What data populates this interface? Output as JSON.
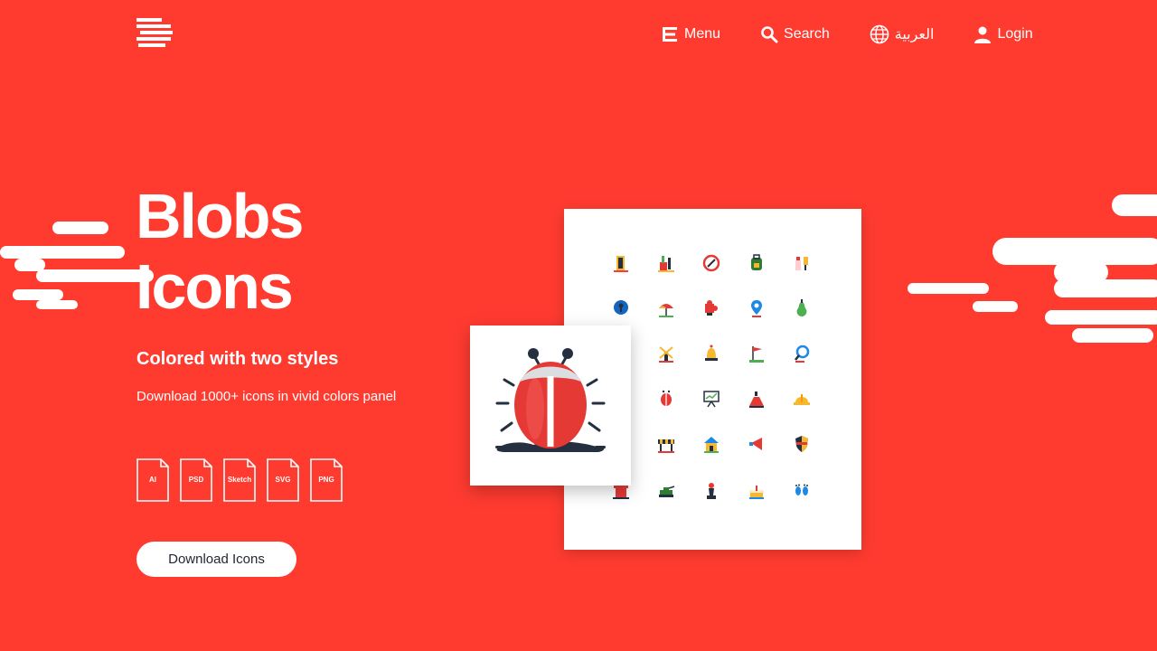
{
  "nav": {
    "menu_label": "Menu",
    "search_label": "Search",
    "language_label": "العربية",
    "login_label": "Login"
  },
  "hero": {
    "title_line1": "Blobs",
    "title_line2": "Icons",
    "subtitle": "Colored with two styles",
    "description": "Download 1000+ icons in vivid colors panel",
    "download_label": "Download Icons"
  },
  "formats": [
    "AI",
    "PSD",
    "Sketch",
    "SVG",
    "PNG"
  ],
  "colors": {
    "background": "#ff3b30",
    "button_text": "#1f2430",
    "bug_red": "#e53935",
    "dark": "#243040"
  },
  "icon_grid": [
    "door-icon",
    "paint-brushes-icon",
    "compass-icon",
    "backpack-icon",
    "baby-bottle-icon",
    "keyhole-icon",
    "umbrella-icon",
    "puzzle-icon",
    "location-pin-icon",
    "pear-icon",
    "windmill-icon",
    "bell-icon",
    "flag-icon",
    "magnifier-icon",
    "ladybug-icon",
    "presentation-board-icon",
    "volcano-icon",
    "helmet-icon",
    "barrier-icon",
    "house-icon",
    "megaphone-icon",
    "shield-icon",
    "chimney-icon",
    "tank-icon",
    "chess-pawn-icon",
    "cake-icon",
    "footprints-icon"
  ],
  "featured_icon": "ladybug-icon"
}
